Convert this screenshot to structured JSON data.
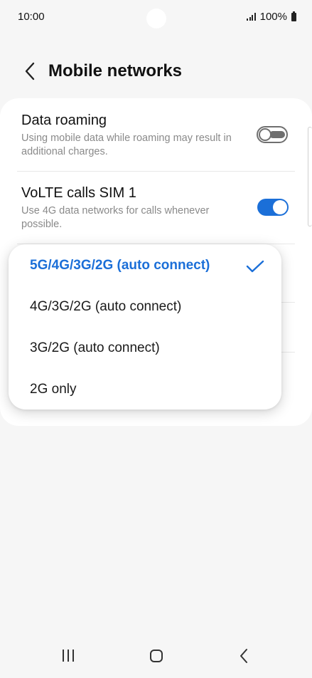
{
  "status_bar": {
    "time": "10:00",
    "battery": "100%",
    "icons": [
      "signal-icon",
      "battery-icon"
    ]
  },
  "header": {
    "title": "Mobile networks",
    "back_icon": "chevron-left-icon"
  },
  "settings": [
    {
      "title": "Data roaming",
      "subtitle": "Using mobile data while roaming may result in additional charges.",
      "toggle": "off"
    },
    {
      "title": "VoLTE calls SIM 1",
      "subtitle": "Use 4G data networks for calls whenever possible.",
      "toggle": "on"
    }
  ],
  "network_mode_menu": {
    "options": [
      "5G/4G/3G/2G (auto connect)",
      "4G/3G/2G (auto connect)",
      "3G/2G (auto connect)",
      "2G only"
    ],
    "selected_index": 0
  },
  "nav_bar": {
    "icons": [
      "recent-apps-icon",
      "home-icon",
      "back-icon"
    ]
  },
  "colors": {
    "accent": "#1b6fd8",
    "background": "#f6f6f6",
    "card": "#ffffff",
    "subtitle": "#8a8a8a"
  }
}
